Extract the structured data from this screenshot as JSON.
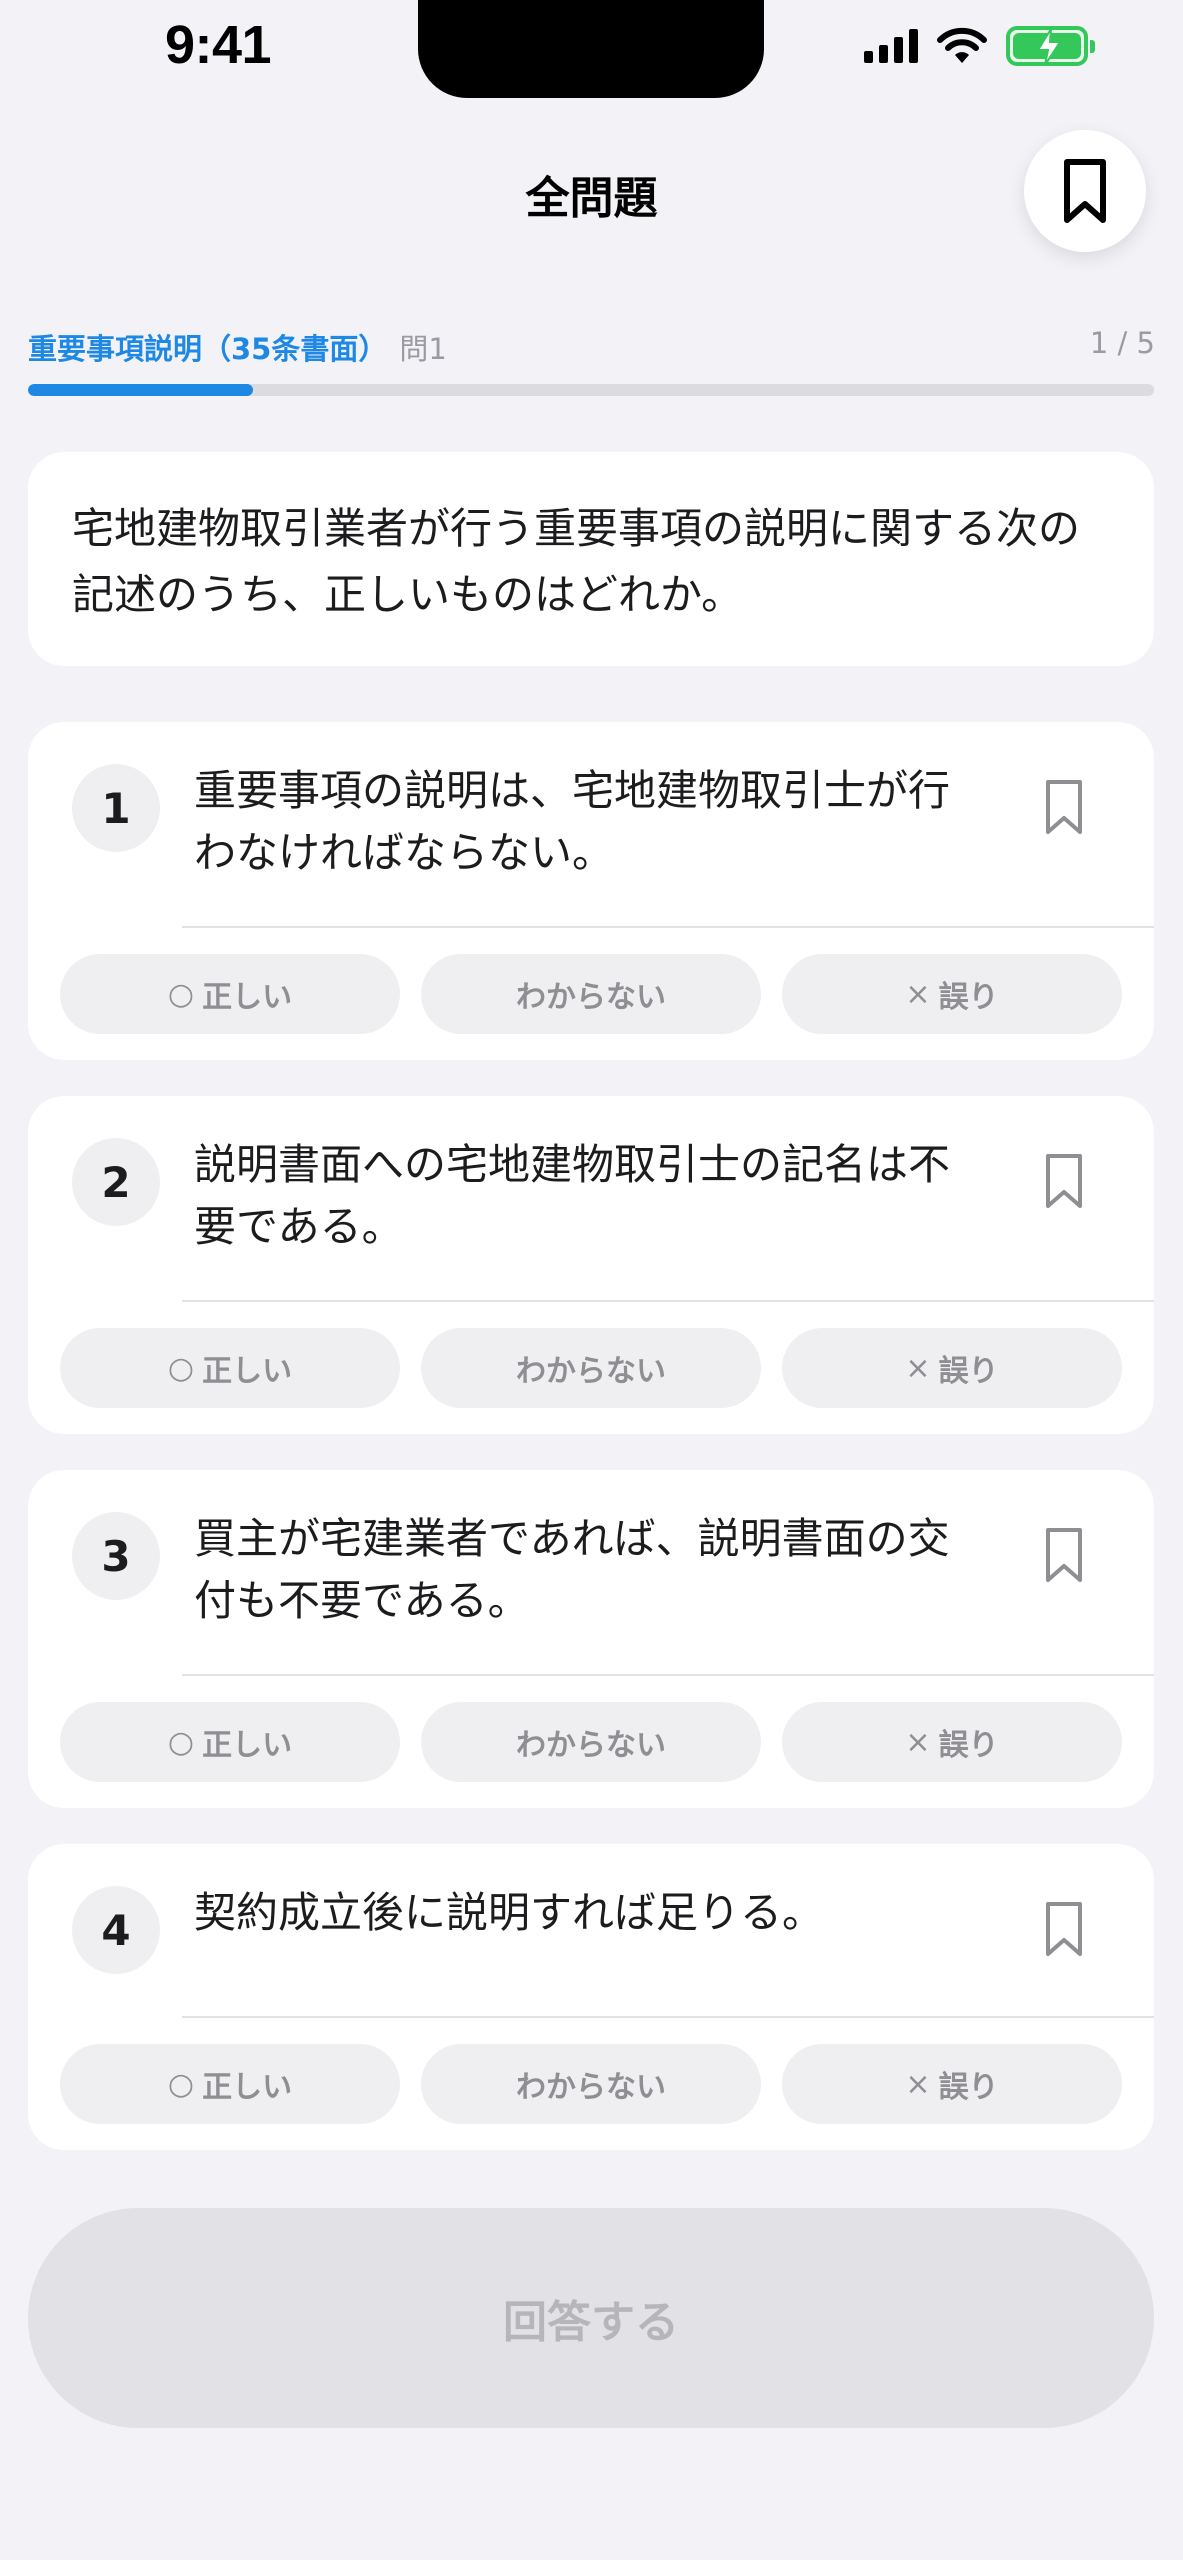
{
  "status_bar": {
    "time": "9:41"
  },
  "header": {
    "title": "全問題",
    "bookmark_icon": "bookmark-icon"
  },
  "progress": {
    "topic": "重要事項説明（35条書面）",
    "question_label": "問1",
    "counter": "1 / 5",
    "fraction": 0.2,
    "accent": "#1e88e5"
  },
  "question": {
    "text": "宅地建物取引業者が行う重要事項の説明に関する次の記述のうち、正しいものはどれか。"
  },
  "choices": [
    {
      "number": "1",
      "text": "重要事項の説明は、宅地建物取引士が行わなければならない。"
    },
    {
      "number": "2",
      "text": "説明書面への宅地建物取引士の記名は不要である。"
    },
    {
      "number": "3",
      "text": "買主が宅建業者であれば、説明書面の交付も不要である。"
    },
    {
      "number": "4",
      "text": "契約成立後に説明すれば足りる。"
    }
  ],
  "answers": {
    "correct_glyph": "○",
    "correct": "正しい",
    "unknown": "わからない",
    "wrong_glyph": "×",
    "wrong": "誤り"
  },
  "submit": {
    "label": "回答する"
  }
}
